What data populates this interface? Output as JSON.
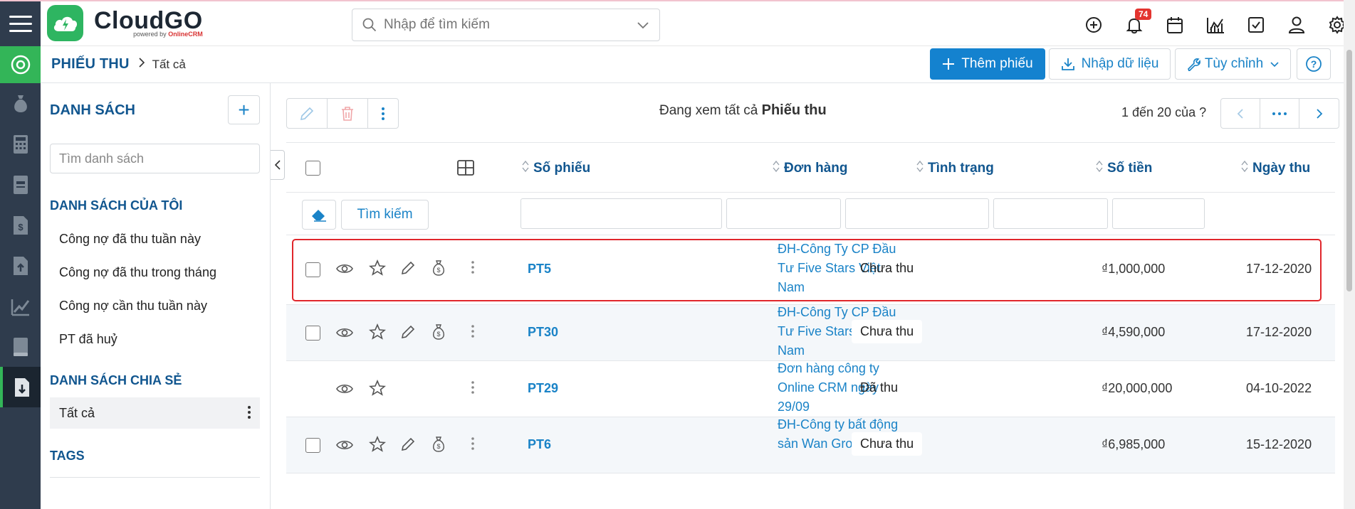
{
  "app": {
    "name": "CloudGO",
    "tagline_prefix": "powered by",
    "tagline_brand": "OnlineCRM"
  },
  "search": {
    "placeholder": "Nhập để tìm kiếm"
  },
  "notifications": {
    "count": "74"
  },
  "breadcrumb": {
    "module": "PHIẾU THU",
    "current": "Tất cả"
  },
  "actions": {
    "add": "Thêm phiếu",
    "import": "Nhập dữ liệu",
    "customize": "Tùy chỉnh"
  },
  "left_panel": {
    "title": "DANH SÁCH",
    "search_placeholder": "Tìm danh sách",
    "my_lists_title": "DANH SÁCH CỦA TÔI",
    "my_lists": [
      "Công nợ đã thu tuần này",
      "Công nợ đã thu trong tháng",
      "Công nợ cần thu tuần này",
      "PT đã huỷ"
    ],
    "shared_title": "DANH SÁCH CHIA SẺ",
    "shared": [
      "Tất cả"
    ],
    "tags_title": "TAGS"
  },
  "list": {
    "viewing_prefix": "Đang xem tất cả",
    "viewing_module": "Phiếu thu",
    "pager_text": "1 đến 20 của ?",
    "columns": [
      "Số phiếu",
      "Đơn hàng",
      "Tình trạng",
      "Số tiền",
      "Ngày thu"
    ],
    "search_button": "Tìm kiếm",
    "rows": [
      {
        "number": "PT5",
        "order": "ĐH-Công Ty CP Đầu Tư Five Stars Việt Nam",
        "status": "Chưa thu",
        "amount": "₫1,000,000",
        "date": "17-12-2020"
      },
      {
        "number": "PT30",
        "order": "ĐH-Công Ty CP Đầu Tư Five Stars Việt Nam",
        "status": "Chưa thu",
        "amount": "₫4,590,000",
        "date": "17-12-2020"
      },
      {
        "number": "PT29",
        "order": "Đơn hàng công ty Online CRM ngày 29/09",
        "status": "Đã thu",
        "amount": "₫20,000,000",
        "date": "04-10-2022"
      },
      {
        "number": "PT6",
        "order": "ĐH-Công ty bất động sản Wan Group",
        "status": "Chưa thu",
        "amount": "₫6,985,000",
        "date": "15-12-2020"
      }
    ]
  },
  "colors": {
    "primary": "#1482cf",
    "brand_green": "#33b558",
    "nav_dark": "#2f3c4d",
    "highlight": "#e0262b"
  }
}
